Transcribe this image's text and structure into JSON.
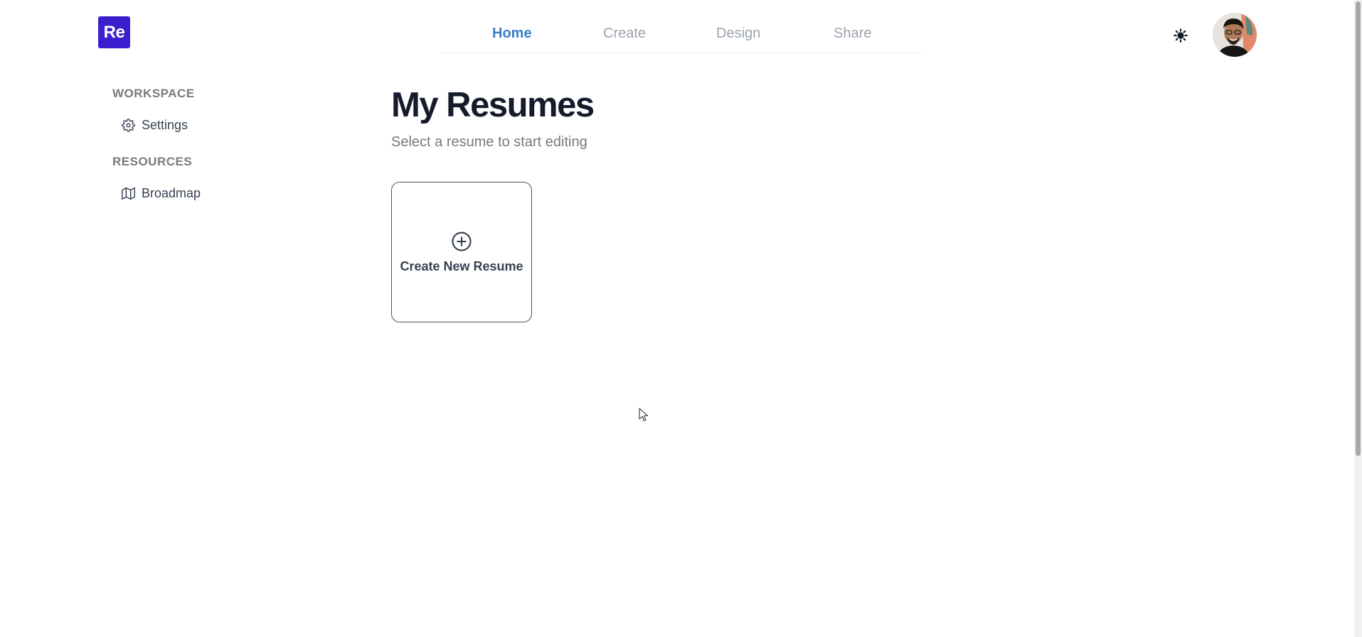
{
  "logo": {
    "text": "Re",
    "color": "#3a1fcf"
  },
  "nav": {
    "tabs": [
      {
        "label": "Home",
        "active": true
      },
      {
        "label": "Create",
        "active": false
      },
      {
        "label": "Design",
        "active": false
      },
      {
        "label": "Share",
        "active": false
      }
    ],
    "active_color": "#3b7ec4"
  },
  "header": {
    "theme_icon": "sun-icon",
    "avatar_icon": "user-avatar"
  },
  "sidebar": {
    "workspace_title": "WORKSPACE",
    "settings": {
      "label": "Settings",
      "icon": "gear-icon"
    },
    "resources_title": "RESOURCES",
    "broadmap": {
      "label": "Broadmap",
      "icon": "map-icon"
    }
  },
  "main": {
    "title": "My Resumes",
    "subtitle": "Select a resume to start editing",
    "create_card": {
      "label": "Create New Resume",
      "icon": "plus-circle-icon"
    }
  }
}
